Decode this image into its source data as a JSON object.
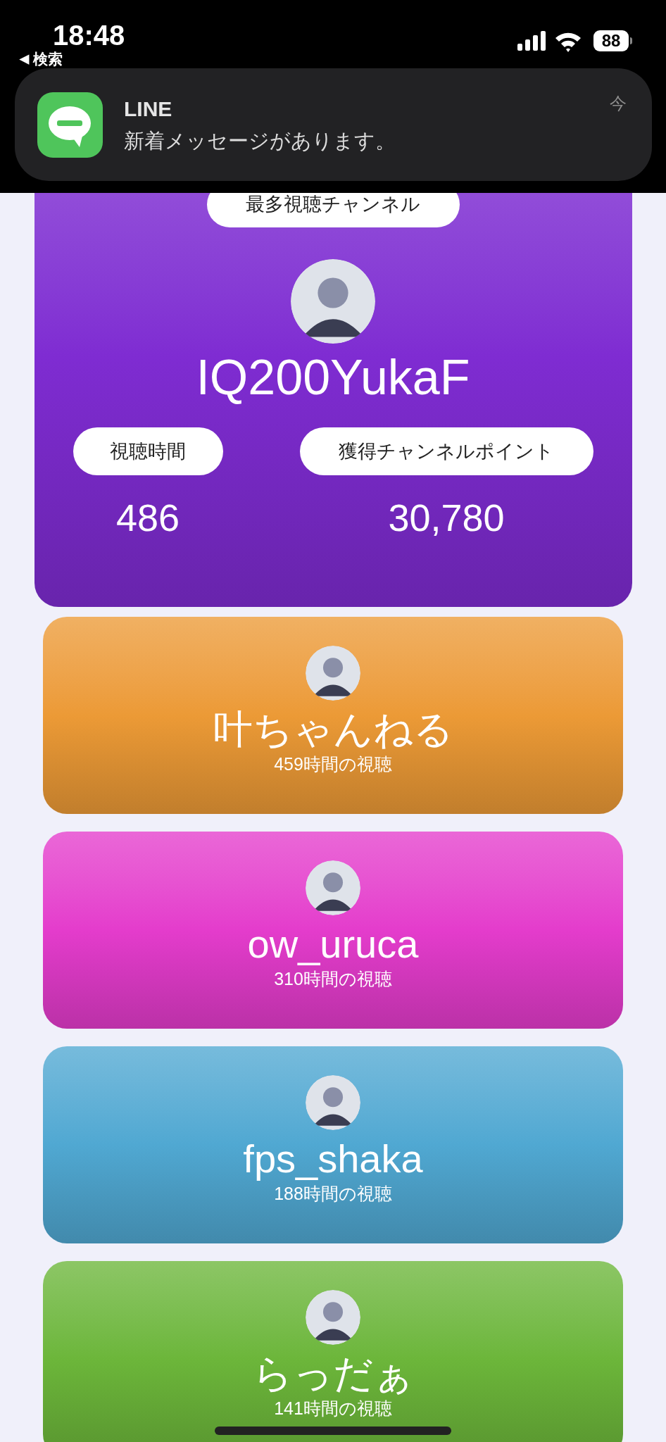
{
  "status_bar": {
    "time": "18:48",
    "back_icon": "◀",
    "back_label": "検索",
    "battery": "88"
  },
  "notification": {
    "app": "LINE",
    "message": "新着メッセージがあります。",
    "time": "今"
  },
  "top_channel": {
    "badge": "最多視聴チャンネル",
    "name": "IQ200YukaF",
    "color": "#7f2cd2",
    "stats": [
      {
        "label": "視聴時間",
        "value": "486"
      },
      {
        "label": "獲得チャンネルポイント",
        "value": "30,780"
      }
    ]
  },
  "channels": [
    {
      "name": "叶ちゃんねる",
      "hours": "459時間の視聴",
      "color": "#ec9a36"
    },
    {
      "name": "ow_uruca",
      "hours": "310時間の視聴",
      "color": "#e43ccc"
    },
    {
      "name": "fps_shaka",
      "hours": "188時間の視聴",
      "color": "#50a8d2"
    },
    {
      "name": "らっだぁ",
      "hours": "141時間の視聴",
      "color": "#6cb63a"
    }
  ]
}
